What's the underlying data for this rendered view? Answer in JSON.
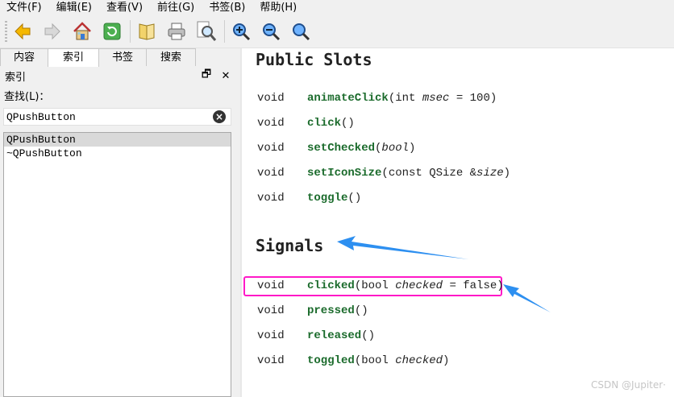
{
  "menu": [
    {
      "label": "文件(F)"
    },
    {
      "label": "编辑(E)"
    },
    {
      "label": "查看(V)"
    },
    {
      "label": "前往(G)"
    },
    {
      "label": "书签(B)"
    },
    {
      "label": "帮助(H)"
    }
  ],
  "toolbar": {
    "icons": [
      "back-icon",
      "forward-icon",
      "home-icon",
      "sync-icon",
      "bookmark-book-icon",
      "print-icon",
      "find-icon",
      "zoom-in-icon",
      "zoom-out-icon",
      "zoom-reset-icon"
    ]
  },
  "tabs": [
    {
      "label": "内容"
    },
    {
      "label": "索引"
    },
    {
      "label": "书签"
    },
    {
      "label": "搜索"
    }
  ],
  "dock": {
    "title": "索引",
    "float_glyph": "🗗",
    "close_glyph": "✕"
  },
  "find": {
    "label": "查找(L)：",
    "value": "QPushButton"
  },
  "index_items": [
    {
      "label": "QPushButton"
    },
    {
      "label": "~QPushButton"
    }
  ],
  "doc": {
    "section1_title": "Public Slots",
    "section2_title": "Signals",
    "slots": [
      {
        "kw": "void",
        "name": "animateClick",
        "pre": "(int ",
        "arg": "msec",
        "post": " = 100)"
      },
      {
        "kw": "void",
        "name": "click",
        "pre": "()",
        "arg": "",
        "post": ""
      },
      {
        "kw": "void",
        "name": "setChecked",
        "pre": "(",
        "arg": "bool",
        "post": ")"
      },
      {
        "kw": "void",
        "name": "setIconSize",
        "pre": "(const QSize &",
        "arg": "size",
        "post": ")"
      },
      {
        "kw": "void",
        "name": "toggle",
        "pre": "()",
        "arg": "",
        "post": ""
      }
    ],
    "signals": [
      {
        "kw": "void",
        "name": "clicked",
        "pre": "(bool ",
        "arg": "checked",
        "post": " = false)"
      },
      {
        "kw": "void",
        "name": "pressed",
        "pre": "()",
        "arg": "",
        "post": ""
      },
      {
        "kw": "void",
        "name": "released",
        "pre": "()",
        "arg": "",
        "post": ""
      },
      {
        "kw": "void",
        "name": "toggled",
        "pre": "(bool ",
        "arg": "checked",
        "post": ")"
      }
    ]
  },
  "watermark": "CSDN @Jupiter·",
  "colors": {
    "function_name": "#1b6b2c",
    "highlight_box": "#ff19c8",
    "arrow": "#1e90ff"
  }
}
